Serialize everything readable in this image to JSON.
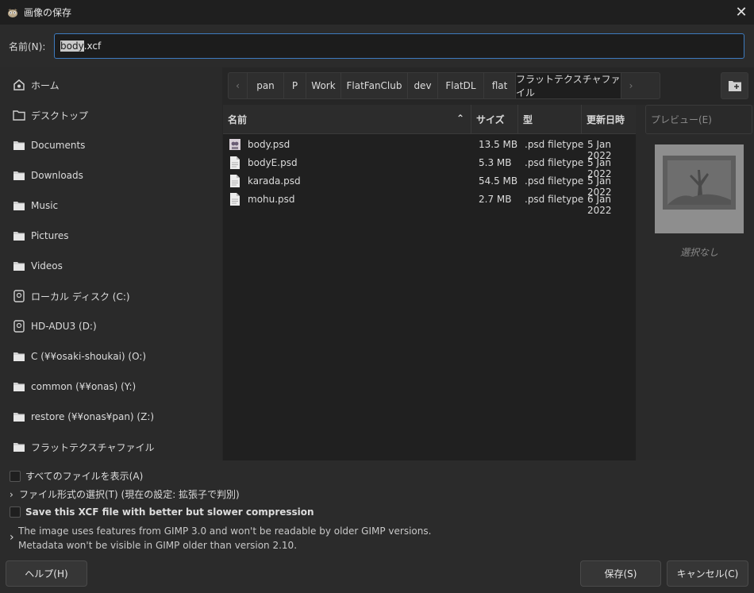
{
  "window": {
    "title": "画像の保存",
    "close_glyph": "✕"
  },
  "name_field": {
    "label": "名前(N):",
    "selected_part": "body",
    "rest_part": ".xcf"
  },
  "sidebar": {
    "items": [
      {
        "label": "ホーム",
        "icon": "home-icon"
      },
      {
        "label": "デスクトップ",
        "icon": "folder-icon"
      },
      {
        "label": "Documents",
        "icon": "folder-icon"
      },
      {
        "label": "Downloads",
        "icon": "folder-icon"
      },
      {
        "label": "Music",
        "icon": "folder-icon"
      },
      {
        "label": "Pictures",
        "icon": "folder-icon"
      },
      {
        "label": "Videos",
        "icon": "folder-icon"
      },
      {
        "label": "ローカル ディスク (C:)",
        "icon": "drive-icon"
      },
      {
        "label": "HD-ADU3 (D:)",
        "icon": "drive-icon"
      },
      {
        "label": "C (¥¥osaki-shoukai) (O:)",
        "icon": "folder-icon"
      },
      {
        "label": "common (¥¥onas) (Y:)",
        "icon": "folder-icon"
      },
      {
        "label": "restore (¥¥onas¥pan) (Z:)",
        "icon": "folder-icon"
      },
      {
        "label": "フラットテクスチャファイル",
        "icon": "folder-icon"
      }
    ]
  },
  "pathbar": {
    "crumbs": [
      "pan",
      "P",
      "Work",
      "FlatFanClub",
      "dev",
      "FlatDL",
      "flat",
      "フラットテクスチャファイル"
    ],
    "left_arrow": "‹",
    "right_arrow": "›"
  },
  "filelist": {
    "columns": {
      "name": "名前",
      "size": "サイズ",
      "type": "型",
      "modified": "更新日時"
    },
    "sort_glyph": "⌃",
    "rows": [
      {
        "name": "body.psd",
        "size": "13.5 MB",
        "type": ".psd filetype",
        "modified": "5 Jan 2022",
        "icon": "image-thumbnail-icon"
      },
      {
        "name": "bodyE.psd",
        "size": "5.3 MB",
        "type": ".psd filetype",
        "modified": "5 Jan 2022",
        "icon": "file-icon"
      },
      {
        "name": "karada.psd",
        "size": "54.5 MB",
        "type": ".psd filetype",
        "modified": "5 Jan 2022",
        "icon": "file-icon"
      },
      {
        "name": "mohu.psd",
        "size": "2.7 MB",
        "type": ".psd filetype",
        "modified": "6 Jan 2022",
        "icon": "file-icon"
      }
    ]
  },
  "preview": {
    "header": "プレビュー(E)",
    "no_selection": "選択なし"
  },
  "options": {
    "show_all": "すべてのファイルを表示(A)",
    "file_type": "ファイル形式の選択(T) (現在の設定: 拡張子で判別)",
    "compression": "Save this XCF file with better but slower compression",
    "warning_line1": "The image uses features from GIMP 3.0 and won't be readable by older GIMP versions.",
    "warning_line2": "Metadata won't be visible in GIMP older than version 2.10."
  },
  "buttons": {
    "help": "ヘルプ(H)",
    "save": "保存(S)",
    "cancel": "キャンセル(C)"
  },
  "colors": {
    "accent": "#3d7bbf",
    "background": "#262626"
  }
}
